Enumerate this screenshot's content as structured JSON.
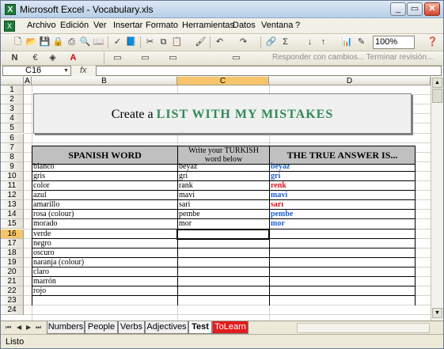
{
  "window": {
    "title": "Microsoft Excel - Vocabulary.xls",
    "minimize": "_",
    "restore": "▭",
    "close": "✕"
  },
  "menu": [
    "Archivo",
    "Edición",
    "Ver",
    "Insertar",
    "Formato",
    "Herramientas",
    "Datos",
    "Ventana",
    "?"
  ],
  "toolbar": {
    "zoom": "100%",
    "review": "Responder con cambios... Terminar revisión..."
  },
  "formula_bar": {
    "cell_ref": "C16",
    "fx": "fx",
    "value": ""
  },
  "columns": [
    "A",
    "B",
    "C",
    "D"
  ],
  "rows": [
    "1",
    "2",
    "3",
    "4",
    "5",
    "6",
    "7",
    "8",
    "9",
    "10",
    "11",
    "12",
    "13",
    "14",
    "15",
    "16",
    "17",
    "18",
    "19",
    "20",
    "21",
    "22",
    "23",
    "24"
  ],
  "selected": {
    "column": "C",
    "row": "16"
  },
  "title_box": {
    "prefix": "Create a",
    "highlight": "LIST WITH MY MISTAKES"
  },
  "table": {
    "headers": {
      "spanish": "SPANISH WORD",
      "turkish": "Write your TURKISH word below",
      "answer": "THE TRUE ANSWER IS..."
    },
    "rows": [
      {
        "spanish": "blanco",
        "turkish": "beyaz",
        "answer": "beyaz",
        "correct": true
      },
      {
        "spanish": "gris",
        "turkish": "gri",
        "answer": "gri",
        "correct": true
      },
      {
        "spanish": "color",
        "turkish": "rank",
        "answer": "renk",
        "correct": false
      },
      {
        "spanish": "azul",
        "turkish": "mavi",
        "answer": "mavi",
        "correct": true
      },
      {
        "spanish": "amarillo",
        "turkish": "sari",
        "answer": "sarı",
        "correct": false
      },
      {
        "spanish": "rosa (colour)",
        "turkish": "pembe",
        "answer": "pembe",
        "correct": true
      },
      {
        "spanish": "morado",
        "turkish": "mor",
        "answer": "mor",
        "correct": true
      },
      {
        "spanish": "verde",
        "turkish": "",
        "answer": "",
        "correct": null
      },
      {
        "spanish": "negro",
        "turkish": "",
        "answer": "",
        "correct": null
      },
      {
        "spanish": "oscuro",
        "turkish": "",
        "answer": "",
        "correct": null
      },
      {
        "spanish": "naranja (colour)",
        "turkish": "",
        "answer": "",
        "correct": null
      },
      {
        "spanish": "claro",
        "turkish": "",
        "answer": "",
        "correct": null
      },
      {
        "spanish": "marrón",
        "turkish": "",
        "answer": "",
        "correct": null
      },
      {
        "spanish": "rojo",
        "turkish": "",
        "answer": "",
        "correct": null
      }
    ]
  },
  "colors": {
    "correct": "#1f5fd1",
    "wrong": "#e0131d",
    "title_highlight": "#2e8b57",
    "active_tab": "#e21c1c"
  },
  "tabs": {
    "nav": [
      "⏮",
      "◀",
      "▶",
      "⏭"
    ],
    "sheets": [
      "Numbers",
      "People",
      "Verbs",
      "Adjectives",
      "Test",
      "ToLearn"
    ],
    "active": "Test"
  },
  "status": "Listo"
}
